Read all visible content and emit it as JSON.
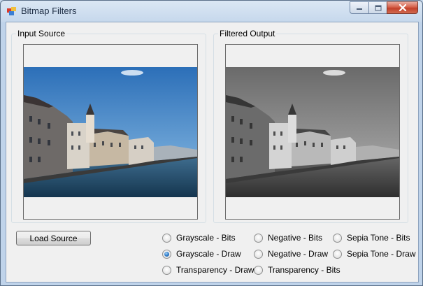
{
  "window": {
    "title": "Bitmap Filters"
  },
  "groups": {
    "input_label": "Input Source",
    "output_label": "Filtered Output"
  },
  "buttons": {
    "load_source": "Load Source"
  },
  "filters": {
    "grayscale_bits": "Grayscale - Bits",
    "grayscale_draw": "Grayscale - Draw",
    "transparency_draw": "Transparency - Draw",
    "negative_bits": "Negative - Bits",
    "negative_draw": "Negative - Draw",
    "transparency_bits": "Transparency - Bits",
    "sepia_bits": "Sepia Tone - Bits",
    "sepia_draw": "Sepia Tone - Draw",
    "selected": "grayscale_draw"
  },
  "colors": {
    "titlebar": "#c6d8ec",
    "client": "#f0f0f0",
    "close_button": "#c2402a",
    "radio_selected": "#2b78c6"
  }
}
